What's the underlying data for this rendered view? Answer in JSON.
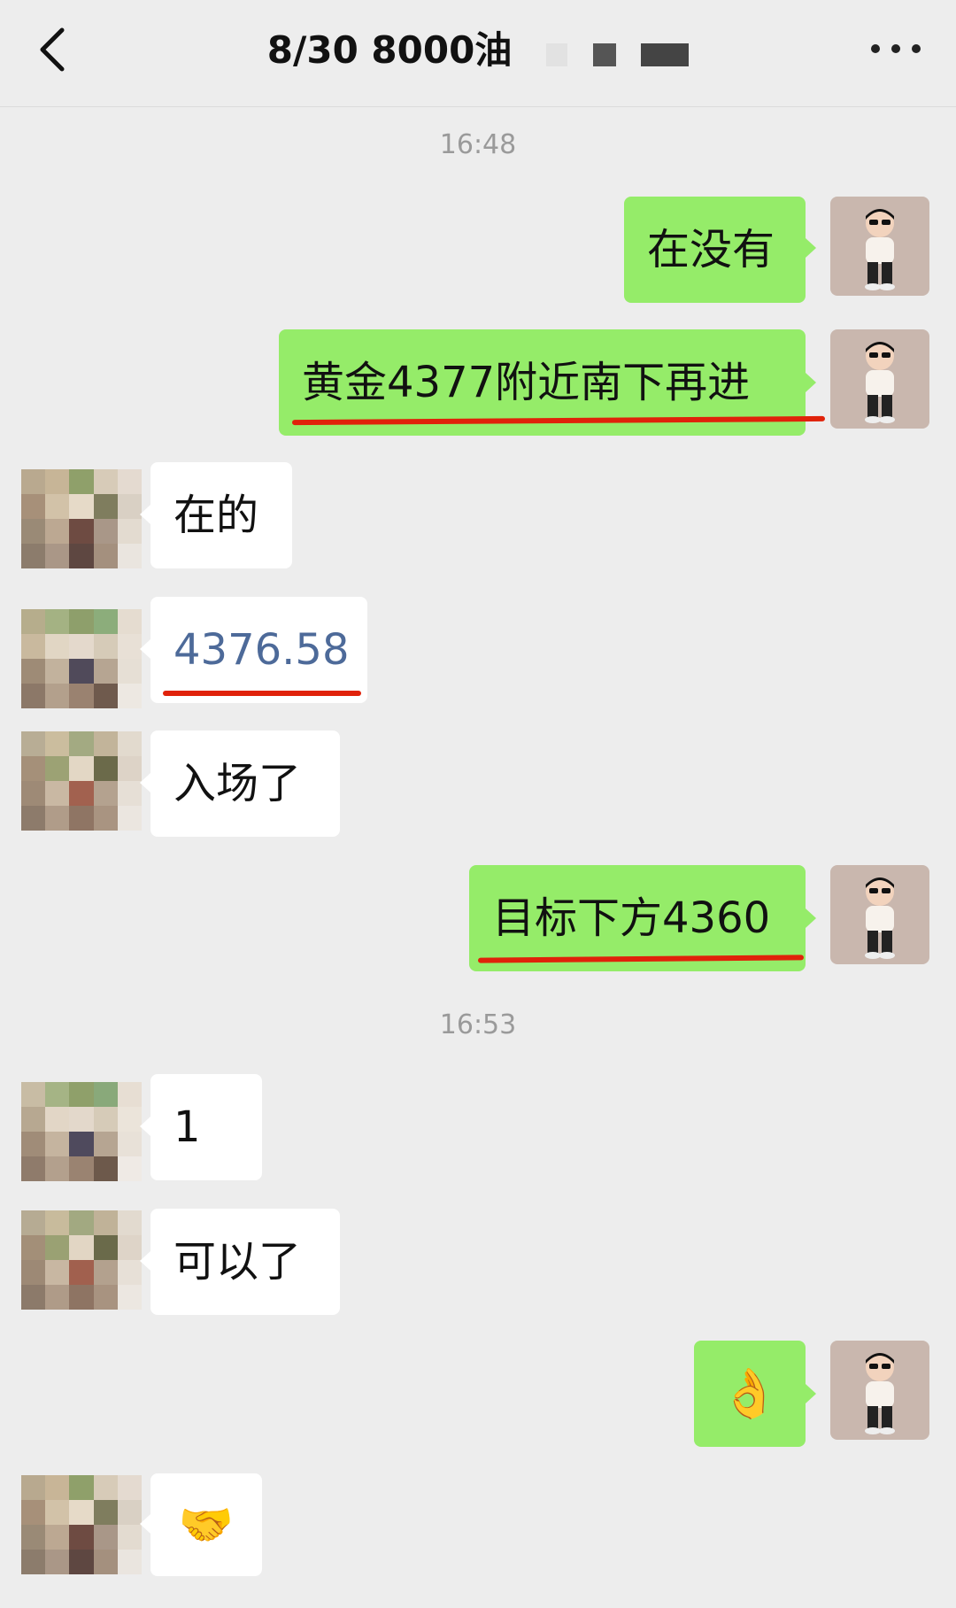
{
  "header": {
    "title": "8/30  8000油",
    "colors": {
      "background": "#ededed",
      "me_bubble": "#95ec69",
      "them_bubble": "#ffffff",
      "underline": "#e0220a"
    }
  },
  "timestamps": [
    "16:48",
    "16:53"
  ],
  "messages": [
    {
      "side": "me",
      "text": "在没有"
    },
    {
      "side": "me",
      "text": "黄金4377附近南下再进"
    },
    {
      "side": "them",
      "text": "在的"
    },
    {
      "side": "them",
      "text": "4376.58"
    },
    {
      "side": "them",
      "text": "入场了"
    },
    {
      "side": "me",
      "text": "目标下方4360"
    },
    {
      "side": "them",
      "text": "1"
    },
    {
      "side": "them",
      "text": "可以了"
    },
    {
      "side": "me",
      "text": "👌"
    },
    {
      "side": "them",
      "text": "🤝"
    }
  ]
}
